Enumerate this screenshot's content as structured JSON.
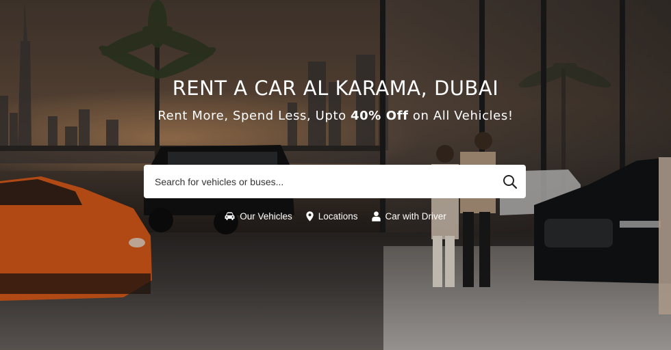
{
  "hero": {
    "title": "RENT A CAR AL KARAMA, DUBAI",
    "subtitle_pre": "Rent More, Spend Less, Upto ",
    "subtitle_bold": "40% Off",
    "subtitle_post": " on All Vehicles!"
  },
  "search": {
    "placeholder": "Search for vehicles or buses...",
    "value": "",
    "button_icon": "search-icon"
  },
  "links": [
    {
      "label": "Our Vehicles",
      "icon": "car-icon"
    },
    {
      "label": "Locations",
      "icon": "map-pin-icon"
    },
    {
      "label": "Car with Driver",
      "icon": "person-icon"
    }
  ],
  "colors": {
    "text": "#ffffff",
    "search_bg": "#ffffff"
  }
}
